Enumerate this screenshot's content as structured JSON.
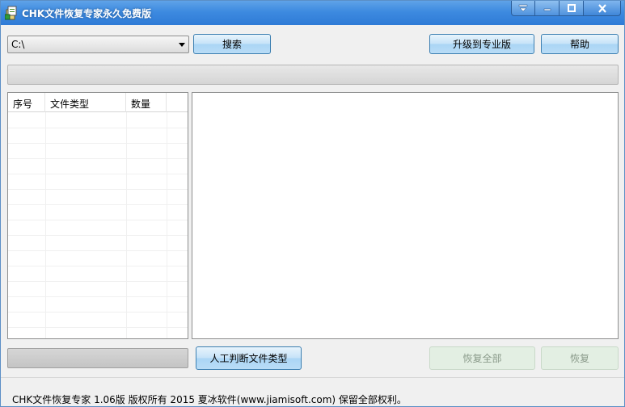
{
  "window": {
    "title": "CHK文件恢复专家永久免费版"
  },
  "toolbar": {
    "drive_selected": "C:\\",
    "search_label": "搜索",
    "upgrade_label": "升级到专业版",
    "help_label": "帮助"
  },
  "file_types_list": {
    "columns": [
      "序号",
      "文件类型",
      "数量"
    ],
    "rows": []
  },
  "bottom": {
    "manual_detect_label": "人工判断文件类型",
    "recover_all_label": "恢复全部",
    "recover_label": "恢复"
  },
  "status": {
    "text": "CHK文件恢复专家 1.06版  版权所有 2015 夏冰软件(www.jiamisoft.com)  保留全部权利。"
  },
  "colors": {
    "titlebar": "#3d8ae0",
    "button_border": "#3c7fb1",
    "disabled_button": "#e3efe3"
  },
  "icons": [
    "app-icon",
    "menu-icon",
    "minimize-icon",
    "maximize-icon",
    "close-icon",
    "chevron-down-icon"
  ]
}
